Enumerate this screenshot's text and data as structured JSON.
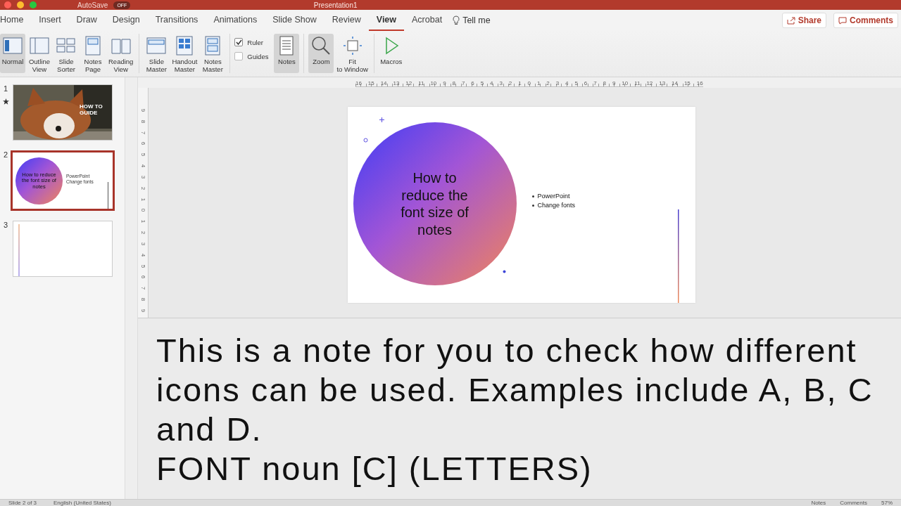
{
  "title_bar": {
    "autosave": "AutoSave",
    "autosave_state": "OFF",
    "document": "Presentation1"
  },
  "tabs": [
    {
      "label": "Home",
      "selected": false
    },
    {
      "label": "Insert",
      "selected": false
    },
    {
      "label": "Draw",
      "selected": false
    },
    {
      "label": "Design",
      "selected": false
    },
    {
      "label": "Transitions",
      "selected": false
    },
    {
      "label": "Animations",
      "selected": false
    },
    {
      "label": "Slide Show",
      "selected": false
    },
    {
      "label": "Review",
      "selected": false
    },
    {
      "label": "View",
      "selected": true
    },
    {
      "label": "Acrobat",
      "selected": false
    }
  ],
  "tell_me": "Tell me",
  "share_button": "Share",
  "comments_button": "Comments",
  "ribbon_groups": [
    {
      "items": [
        {
          "kind": "button",
          "label": "Normal",
          "selected": true
        },
        {
          "kind": "button",
          "label": "Outline View",
          "selected": false
        },
        {
          "kind": "button",
          "label": "Slide Sorter",
          "selected": false
        },
        {
          "kind": "button",
          "label": "Notes Page",
          "selected": false
        },
        {
          "kind": "button",
          "label": "Reading View",
          "selected": false
        }
      ]
    },
    {
      "items": [
        {
          "kind": "button",
          "label": "Slide Master",
          "selected": false
        },
        {
          "kind": "button",
          "label": "Handout Master",
          "selected": false
        },
        {
          "kind": "button",
          "label": "Notes Master",
          "selected": false
        }
      ]
    },
    {
      "items": [
        {
          "kind": "checkbox",
          "label": "Ruler",
          "checked": true
        },
        {
          "kind": "checkbox",
          "label": "Guides",
          "checked": false
        },
        {
          "kind": "button",
          "label": "Notes",
          "selected": true
        }
      ]
    },
    {
      "items": [
        {
          "kind": "button",
          "label": "Zoom",
          "selected": true
        },
        {
          "kind": "button",
          "label": "Fit to Window",
          "selected": false
        }
      ]
    },
    {
      "items": [
        {
          "kind": "button",
          "label": "Macros",
          "selected": false
        }
      ]
    }
  ],
  "thumbnails": [
    {
      "number": "1",
      "starred": true,
      "selected": false,
      "kind": "picture",
      "caption": "HOW TO GUIDE"
    },
    {
      "number": "2",
      "starred": false,
      "selected": true,
      "kind": "title",
      "title": "How to reduce the font size of notes",
      "bullets": [
        "PowerPoint",
        "Change fonts"
      ]
    },
    {
      "number": "3",
      "starred": false,
      "selected": false,
      "kind": "blank"
    }
  ],
  "horizontal_ruler": [
    "16",
    "15",
    "14",
    "13",
    "12",
    "11",
    "10",
    "9",
    "8",
    "7",
    "6",
    "5",
    "4",
    "3",
    "2",
    "1",
    "0",
    "1",
    "2",
    "3",
    "4",
    "5",
    "6",
    "7",
    "8",
    "9",
    "10",
    "11",
    "12",
    "13",
    "14",
    "15",
    "16"
  ],
  "vertical_ruler": [
    "9",
    "8",
    "7",
    "6",
    "5",
    "4",
    "3",
    "2",
    "1",
    "0",
    "1",
    "2",
    "3",
    "4",
    "5",
    "6",
    "7",
    "8",
    "9"
  ],
  "slide": {
    "title": "How to reduce the font size of notes",
    "bullets": [
      "PowerPoint",
      "Change fonts"
    ]
  },
  "notes": [
    "This is a note for you to check how different icons can be used. Examples include A, B, C and D.",
    "FONT noun [C] (LETTERS)"
  ],
  "status_bar": {
    "slide": "Slide 2 of 3",
    "language": "English (United States)",
    "notes": "Notes",
    "comments": "Comments",
    "zoom": "57%"
  }
}
